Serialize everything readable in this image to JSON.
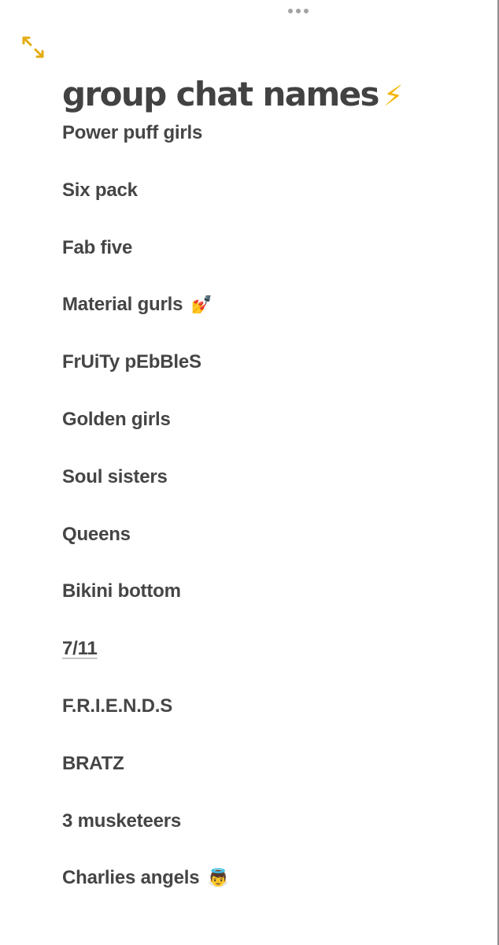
{
  "window": {
    "multitask_icon": "ellipsis-dots",
    "expand_icon": "expand-arrows"
  },
  "note": {
    "title": "group chat names",
    "title_emoji": "⚡",
    "items": [
      {
        "text": "Power puff girls",
        "emoji": ""
      },
      {
        "text": "Six pack",
        "emoji": ""
      },
      {
        "text": "Fab five",
        "emoji": ""
      },
      {
        "text": "Material gurls",
        "emoji": "💅"
      },
      {
        "text": "FrUiTy pEbBleS",
        "emoji": ""
      },
      {
        "text": "Golden girls",
        "emoji": ""
      },
      {
        "text": "Soul sisters",
        "emoji": ""
      },
      {
        "text": "Queens",
        "emoji": ""
      },
      {
        "text": "Bikini bottom",
        "emoji": ""
      },
      {
        "text": "7/11",
        "emoji": "",
        "detected_link": true
      },
      {
        "text": "F.R.I.E.N.D.S",
        "emoji": ""
      },
      {
        "text": "BRATZ",
        "emoji": ""
      },
      {
        "text": "3 musketeers",
        "emoji": ""
      },
      {
        "text": "Charlies angels",
        "emoji": "👼"
      }
    ]
  },
  "colors": {
    "accent": "#E3AC12",
    "text": "#434343",
    "link_underline": "#C6C6C6"
  }
}
